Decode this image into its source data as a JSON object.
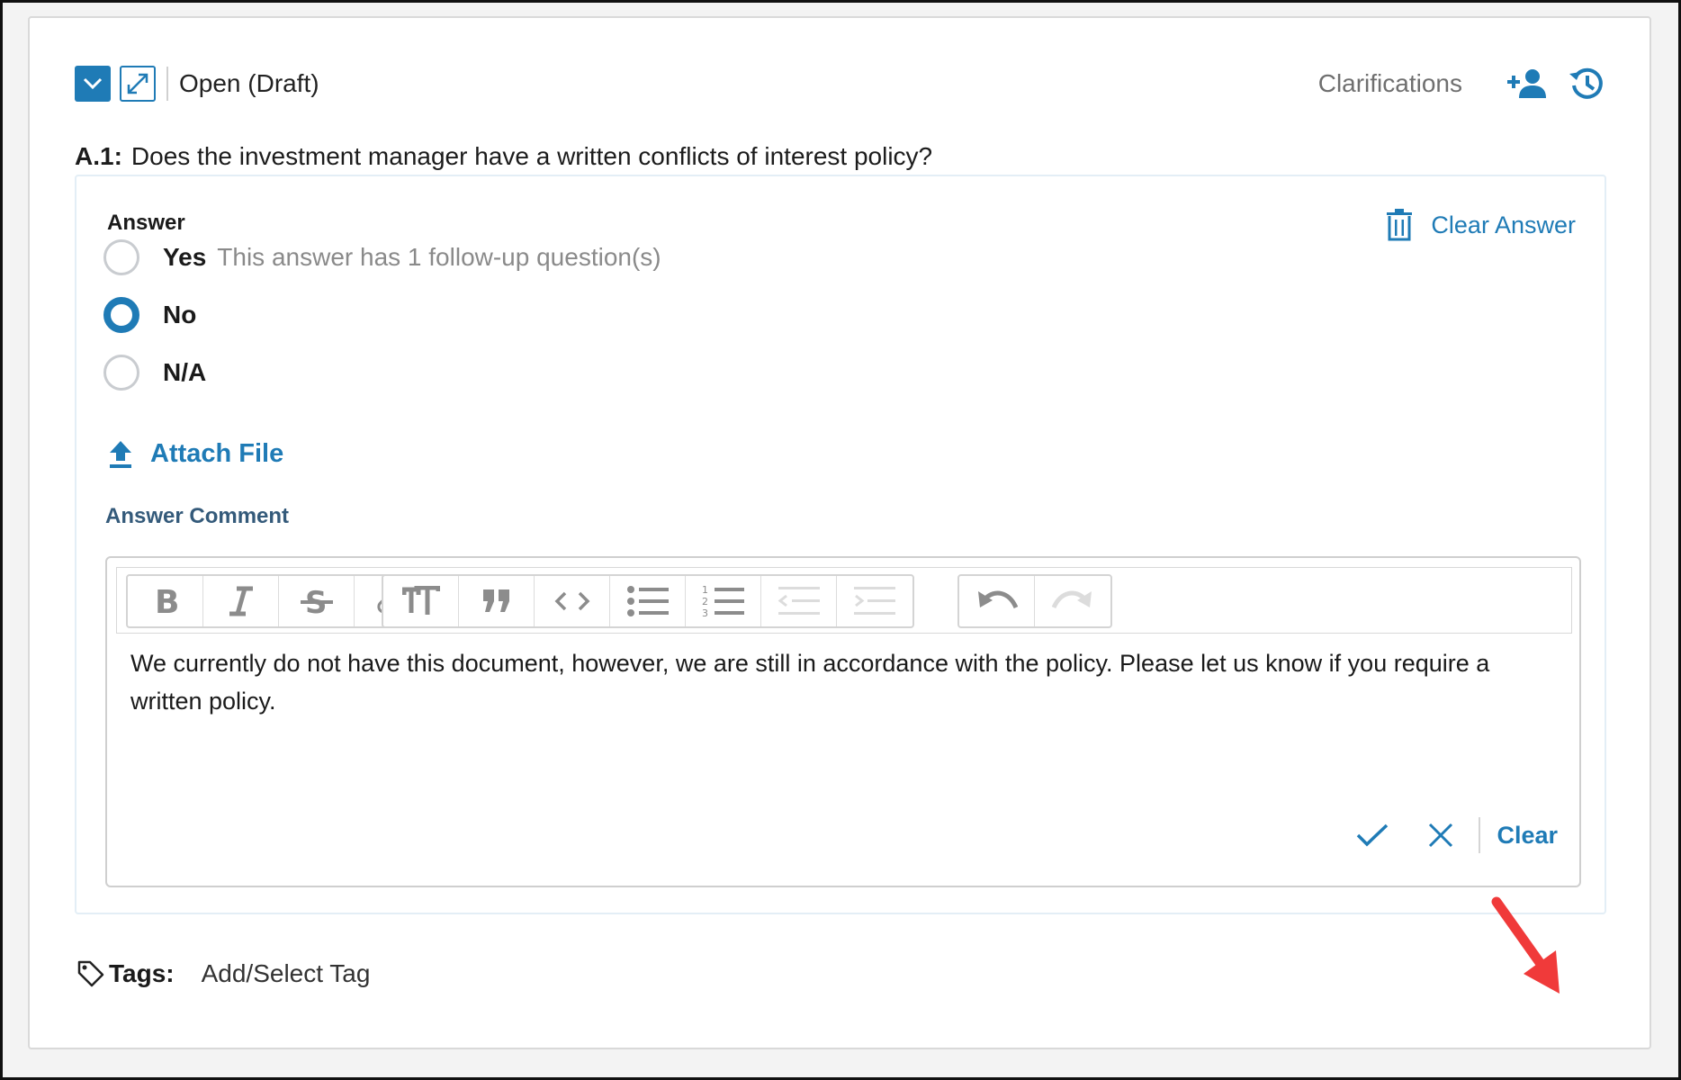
{
  "header": {
    "status": "Open (Draft)",
    "clarifications_label": "Clarifications"
  },
  "question": {
    "id": "A.1:",
    "text": "Does the investment manager have a written conflicts of interest policy?"
  },
  "answer": {
    "label": "Answer",
    "clear_label": "Clear Answer",
    "options": [
      {
        "label": "Yes",
        "note": "This answer has 1 follow-up question(s)",
        "selected": false
      },
      {
        "label": "No",
        "note": "",
        "selected": true
      },
      {
        "label": "N/A",
        "note": "",
        "selected": false
      }
    ],
    "attach_label": "Attach File"
  },
  "comment": {
    "label": "Answer Comment",
    "text": "We currently do not have this document, however, we are still in accordance with the policy. Please let us know if you require a written policy.",
    "clear_label": "Clear"
  },
  "tags": {
    "label": "Tags:",
    "add_label": "Add/Select Tag"
  },
  "colors": {
    "accent": "#1f7bb6",
    "annotation_arrow": "#f03a3a"
  }
}
